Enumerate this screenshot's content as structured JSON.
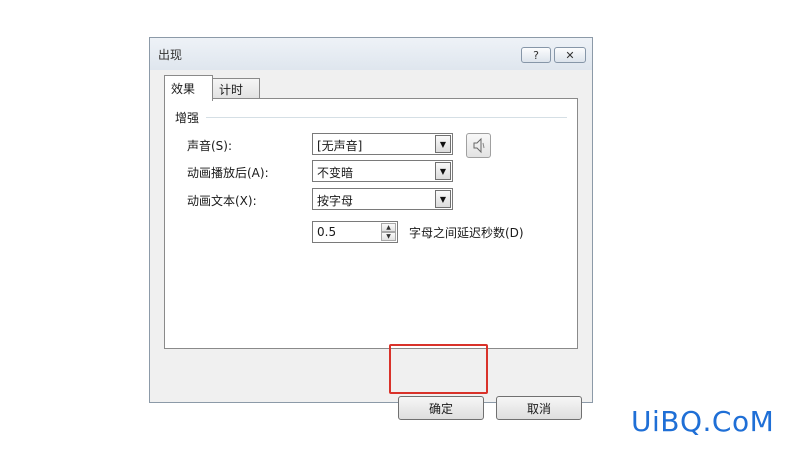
{
  "dialog": {
    "title": "出现",
    "help_label": "?",
    "close_label": "✕"
  },
  "tabs": [
    {
      "label": "效果",
      "active": true
    },
    {
      "label": "计时",
      "active": false
    }
  ],
  "group": {
    "label": "增强"
  },
  "fields": {
    "sound": {
      "label": "声音(S):",
      "value": "[无声音]"
    },
    "after_animation": {
      "label": "动画播放后(A):",
      "value": "不变暗"
    },
    "animate_text": {
      "label": "动画文本(X):",
      "value": "按字母"
    },
    "delay": {
      "value": "0.5",
      "label": "字母之间延迟秒数(D)"
    }
  },
  "buttons": {
    "ok": "确定",
    "cancel": "取消"
  },
  "icons": {
    "sound": "speaker-icon",
    "dropdown": "chevron-down-icon",
    "spin_up": "spin-up-icon",
    "spin_down": "spin-down-icon"
  },
  "colors": {
    "highlight": "#d9322a",
    "watermark": "#1f6fd6"
  },
  "watermark": "UiBQ.CoM"
}
